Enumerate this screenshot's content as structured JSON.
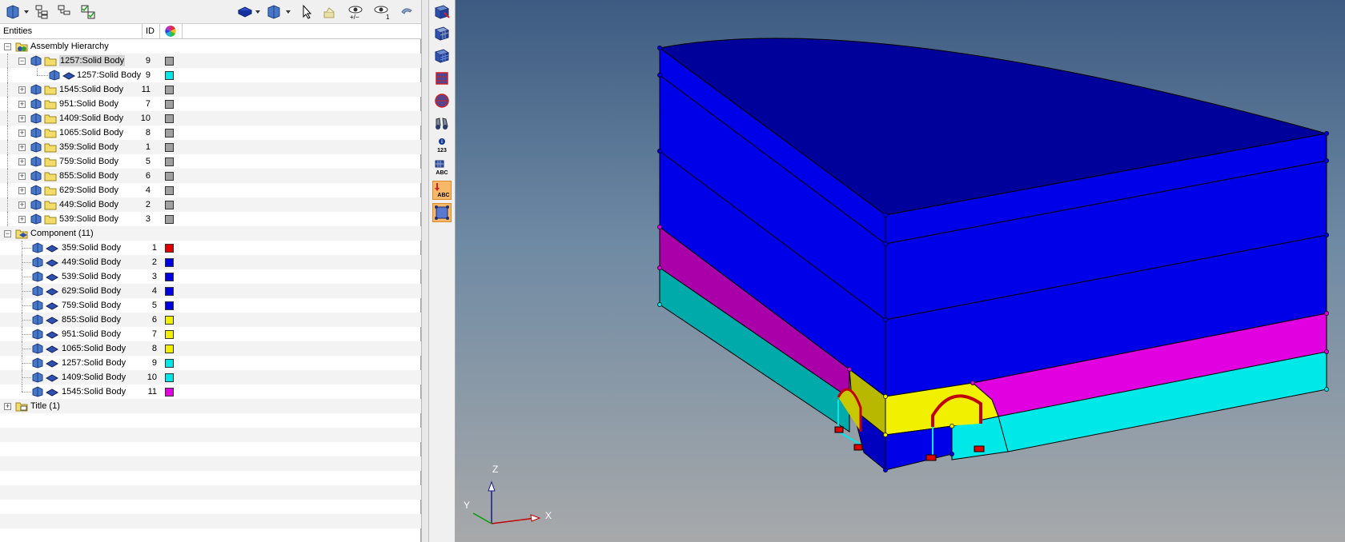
{
  "toolbar": {
    "icons": [
      "component-view-icon",
      "hierarchy-collapse-icon",
      "hierarchy-expand-icon",
      "hierarchy-check-icon",
      "solid-display-icon",
      "component-color-icon",
      "select-cursor-icon",
      "visibility-toggle-icon",
      "show-all-icon",
      "show-one-icon",
      "undo-icon"
    ],
    "show_all_label": "+/−",
    "show_one_label": "1"
  },
  "tree_header": {
    "entities": "Entities",
    "id": "ID",
    "color_icon": "color-wheel-icon"
  },
  "tree": {
    "assembly_hierarchy": "Assembly Hierarchy",
    "assemblies": [
      {
        "label": "1257:Solid Body",
        "id": "9",
        "color": "#a0a0a0",
        "expanded": true,
        "selected": true
      },
      {
        "label": "1257:Solid Body",
        "id": "9",
        "color": "#00e5e5",
        "child": true
      },
      {
        "label": "1545:Solid Body",
        "id": "11",
        "color": "#a0a0a0"
      },
      {
        "label": "951:Solid Body",
        "id": "7",
        "color": "#a0a0a0"
      },
      {
        "label": "1409:Solid Body",
        "id": "10",
        "color": "#a0a0a0"
      },
      {
        "label": "1065:Solid Body",
        "id": "8",
        "color": "#a0a0a0"
      },
      {
        "label": "359:Solid Body",
        "id": "1",
        "color": "#a0a0a0"
      },
      {
        "label": "759:Solid Body",
        "id": "5",
        "color": "#a0a0a0"
      },
      {
        "label": "855:Solid Body",
        "id": "6",
        "color": "#a0a0a0"
      },
      {
        "label": "629:Solid Body",
        "id": "4",
        "color": "#a0a0a0"
      },
      {
        "label": "449:Solid Body",
        "id": "2",
        "color": "#a0a0a0"
      },
      {
        "label": "539:Solid Body",
        "id": "3",
        "color": "#a0a0a0"
      }
    ],
    "component_group": "Component (11)",
    "components": [
      {
        "label": "359:Solid Body",
        "id": "1",
        "color": "#e00000"
      },
      {
        "label": "449:Solid Body",
        "id": "2",
        "color": "#0000e0"
      },
      {
        "label": "539:Solid Body",
        "id": "3",
        "color": "#0000e0"
      },
      {
        "label": "629:Solid Body",
        "id": "4",
        "color": "#0000e0"
      },
      {
        "label": "759:Solid Body",
        "id": "5",
        "color": "#0000e0"
      },
      {
        "label": "855:Solid Body",
        "id": "6",
        "color": "#f0f000"
      },
      {
        "label": "951:Solid Body",
        "id": "7",
        "color": "#f0f000"
      },
      {
        "label": "1065:Solid Body",
        "id": "8",
        "color": "#f0f000"
      },
      {
        "label": "1257:Solid Body",
        "id": "9",
        "color": "#00e5e5"
      },
      {
        "label": "1409:Solid Body",
        "id": "10",
        "color": "#00e5e5"
      },
      {
        "label": "1545:Solid Body",
        "id": "11",
        "color": "#e000e0"
      }
    ],
    "title_group": "Title (1)"
  },
  "side_toolbar": {
    "icons": [
      "mesh-view-icon",
      "mesh-grid-icon",
      "shaded-mesh-icon",
      "mesh-edges-icon",
      "mesh-circle-icon",
      "binoculars-icon",
      "entity-id-icon",
      "entity-name-icon",
      "label-position-icon",
      "bounding-box-icon"
    ],
    "id_label": "123",
    "name_label": "ABC",
    "label_pos_label": "ABC"
  },
  "viewport": {
    "axis_x": "X",
    "axis_y": "Y",
    "axis_z": "Z",
    "colors": {
      "blue": "#0000e8",
      "dark_blue": "#00009a",
      "magenta": "#e000e0",
      "cyan": "#00e8e8",
      "yellow": "#f0f000",
      "red": "#e00000"
    }
  }
}
